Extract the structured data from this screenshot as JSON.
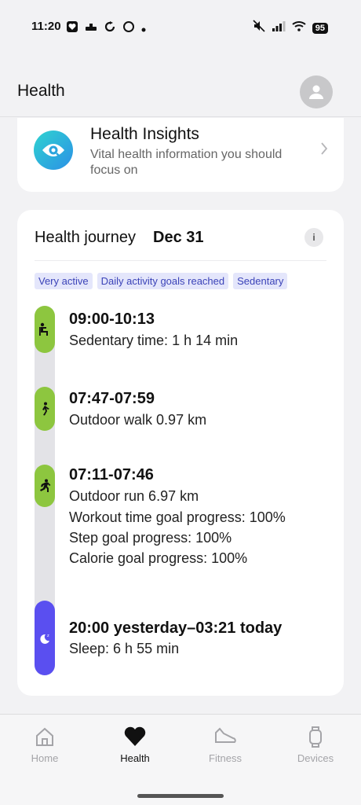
{
  "status_bar": {
    "time": "11:20",
    "battery": "95",
    "left_icons": [
      "notification-app-icon",
      "sync-icon",
      "circle-icon",
      "dot-icon"
    ],
    "right_icons": [
      "mute-icon",
      "signal-icon",
      "wifi-icon",
      "battery-icon"
    ]
  },
  "header": {
    "title": "Health"
  },
  "insights": {
    "title": "Health Insights",
    "description": "Vital health information you should focus on"
  },
  "journey": {
    "title": "Health journey",
    "date": "Dec 31",
    "info_label": "i",
    "chips": [
      "Very active",
      "Daily activity goals reached",
      "Sedentary"
    ],
    "entries": [
      {
        "time": "09:00-10:13",
        "icon": "sedentary-icon",
        "lines": [
          "Sedentary time: 1 h 14 min"
        ]
      },
      {
        "time": "07:47-07:59",
        "icon": "walk-icon",
        "lines": [
          "Outdoor walk 0.97 km"
        ]
      },
      {
        "time": "07:11-07:46",
        "icon": "run-icon",
        "lines": [
          "Outdoor run 6.97 km",
          "Workout time goal progress: 100%",
          "Step goal progress: 100%",
          "Calorie goal progress: 100%"
        ]
      },
      {
        "time": "20:00 yesterday–03:21 today",
        "icon": "sleep-icon",
        "lines": [
          "Sleep: 6 h 55 min"
        ]
      }
    ]
  },
  "bottom_nav": {
    "items": [
      {
        "label": "Home",
        "icon": "home-icon",
        "active": false
      },
      {
        "label": "Health",
        "icon": "heart-icon",
        "active": true
      },
      {
        "label": "Fitness",
        "icon": "shoe-icon",
        "active": false
      },
      {
        "label": "Devices",
        "icon": "watch-icon",
        "active": false
      }
    ]
  },
  "colors": {
    "active_green": "#8dc63f",
    "sleep_purple": "#5a4ff0",
    "chip_bg": "#e4e6fb",
    "chip_text": "#3b43b8"
  }
}
